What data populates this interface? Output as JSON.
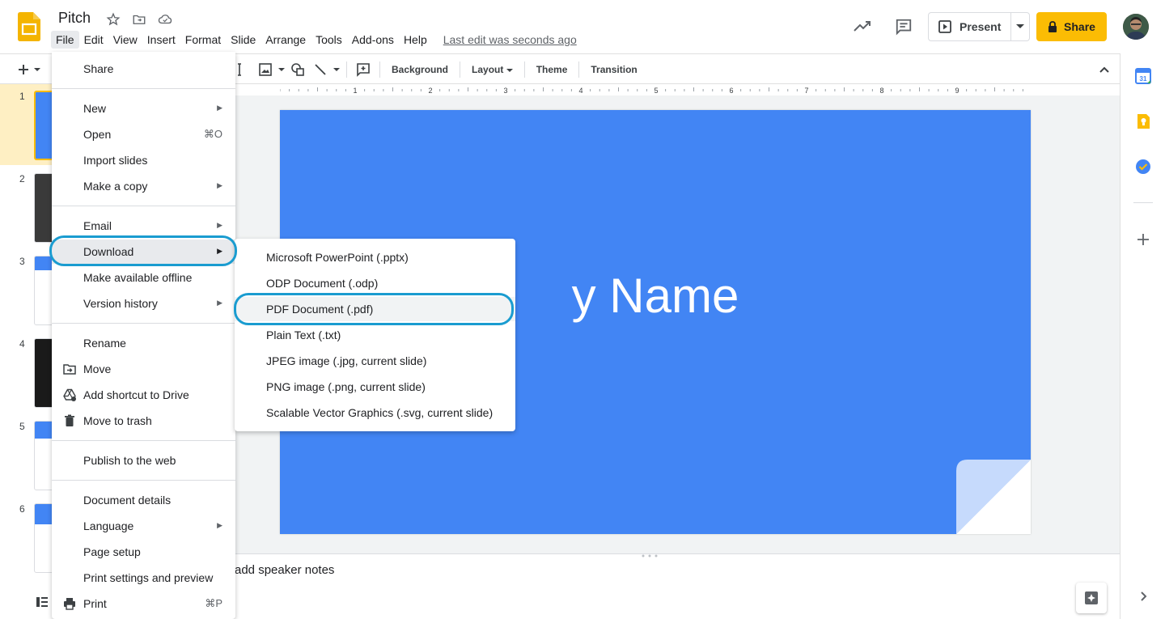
{
  "header": {
    "doc_title": "Pitch",
    "last_edit": "Last edit was seconds ago",
    "present_label": "Present",
    "share_label": "Share"
  },
  "menubar": [
    "File",
    "Edit",
    "View",
    "Insert",
    "Format",
    "Slide",
    "Arrange",
    "Tools",
    "Add-ons",
    "Help"
  ],
  "toolbar": {
    "background": "Background",
    "layout": "Layout",
    "theme": "Theme",
    "transition": "Transition"
  },
  "filmstrip": {
    "slide_numbers": [
      "1",
      "2",
      "3",
      "4",
      "5",
      "6"
    ],
    "selected": "1"
  },
  "ruler_labels": [
    "1",
    "2",
    "3",
    "4",
    "5",
    "6",
    "7",
    "8",
    "9"
  ],
  "slide": {
    "title_visible": "y Name",
    "background_color": "#4285f4"
  },
  "notes_placeholder": "add speaker notes",
  "file_menu": {
    "items": [
      {
        "label": "Share"
      },
      {
        "label": "New",
        "submenu": true
      },
      {
        "label": "Open",
        "shortcut": "⌘O"
      },
      {
        "label": "Import slides"
      },
      {
        "label": "Make a copy",
        "submenu": true
      },
      {
        "label": "Email",
        "submenu": true
      },
      {
        "label": "Download",
        "submenu": true,
        "highlighted": true
      },
      {
        "label": "Make available offline"
      },
      {
        "label": "Version history",
        "submenu": true
      },
      {
        "label": "Rename"
      },
      {
        "label": "Move",
        "icon": "move-icon"
      },
      {
        "label": "Add shortcut to Drive",
        "icon": "drive-shortcut-icon"
      },
      {
        "label": "Move to trash",
        "icon": "trash-icon"
      },
      {
        "label": "Publish to the web"
      },
      {
        "label": "Document details"
      },
      {
        "label": "Language",
        "submenu": true
      },
      {
        "label": "Page setup"
      },
      {
        "label": "Print settings and preview"
      },
      {
        "label": "Print",
        "shortcut": "⌘P",
        "icon": "print-icon"
      }
    ]
  },
  "download_submenu": {
    "items": [
      {
        "label": "Microsoft PowerPoint (.pptx)"
      },
      {
        "label": "ODP Document (.odp)"
      },
      {
        "label": "PDF Document (.pdf)",
        "highlighted": true
      },
      {
        "label": "Plain Text (.txt)"
      },
      {
        "label": "JPEG image (.jpg, current slide)"
      },
      {
        "label": "PNG image (.png, current slide)"
      },
      {
        "label": "Scalable Vector Graphics (.svg, current slide)"
      }
    ]
  },
  "side_panel": [
    "calendar-icon",
    "keep-icon",
    "tasks-icon",
    "add-icon"
  ],
  "colors": {
    "accent_yellow": "#fbbc04",
    "highlight_ring": "#1a9cd0",
    "slide_blue": "#4285f4"
  }
}
